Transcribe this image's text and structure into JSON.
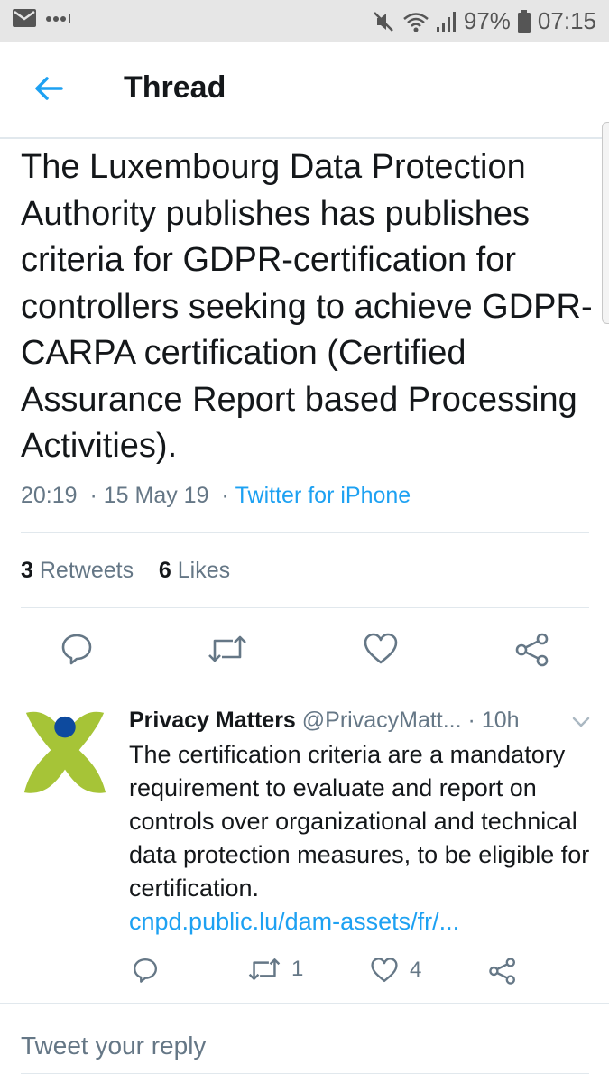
{
  "status_bar": {
    "icons": [
      "mail-icon",
      "dots-icon",
      "mute-icon",
      "wifi-icon",
      "signal-icon",
      "battery-icon"
    ],
    "battery": "97%",
    "time": "07:15"
  },
  "header": {
    "title": "Thread",
    "back_icon": "arrow-left-icon"
  },
  "tweet": {
    "text": "The Luxembourg Data Protection Authority publishes has publishes criteria for GDPR-certification for controllers seeking to achieve GDPR-CARPA certification (Certified Assurance Report based Processing Activities).",
    "time": "20:19",
    "date": "15 May 19",
    "source": "Twitter for iPhone",
    "retweets_count": "3",
    "retweets_label": "Retweets",
    "likes_count": "6",
    "likes_label": "Likes"
  },
  "reply": {
    "name": "Privacy Matters",
    "handle": "@PrivacyMatt...",
    "age": "10h",
    "text": "The certification criteria are a mandatory requirement to evaluate and report on controls over organizational and technical data protection measures, to be eligible for certification.",
    "link": "cnpd.public.lu/dam-assets/fr/...",
    "retweets": "1",
    "likes": "4"
  },
  "compose": {
    "placeholder": "Tweet your reply"
  },
  "colors": {
    "accent": "#1da1f2",
    "text": "#14171a",
    "muted": "#657786",
    "avatar_green": "#a6c437",
    "avatar_blue": "#0d4a9e"
  }
}
